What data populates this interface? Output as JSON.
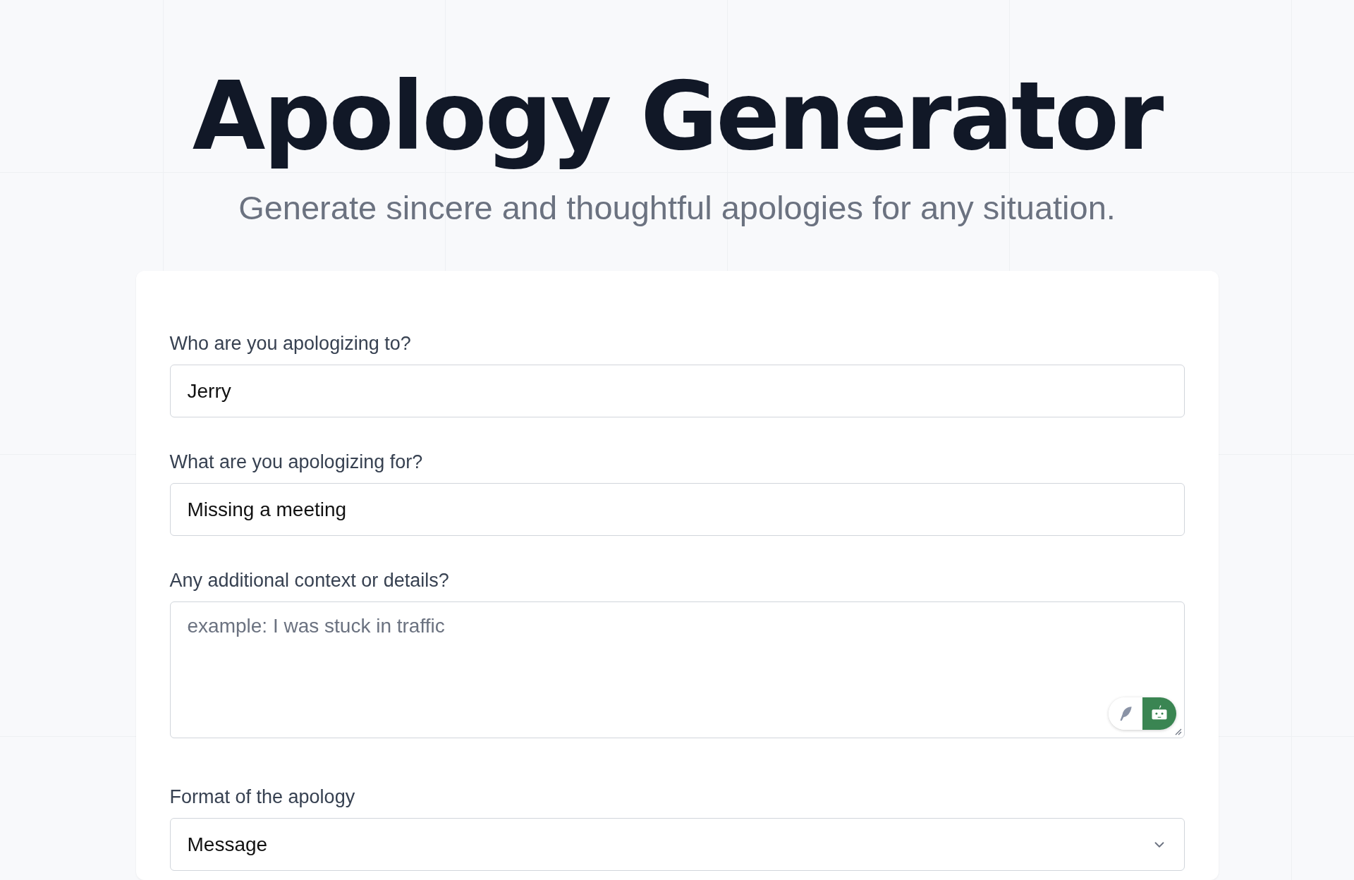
{
  "title": "Apology Generator",
  "subtitle": "Generate sincere and thoughtful apologies for any situation.",
  "fields": [
    {
      "kind": "input",
      "label": "Who are you apologizing to?",
      "value": "Jerry"
    },
    {
      "kind": "input",
      "label": "What are you apologizing for?",
      "value": "Missing a meeting"
    },
    {
      "kind": "textarea",
      "label": "Any additional context or details?",
      "placeholder": "example: I was stuck in traffic",
      "mode_toggle": [
        {
          "kind": "feather",
          "selected": false
        },
        {
          "kind": "robot",
          "selected": true
        }
      ]
    },
    {
      "kind": "select",
      "label": "Format of the apology",
      "value": "Message"
    }
  ]
}
